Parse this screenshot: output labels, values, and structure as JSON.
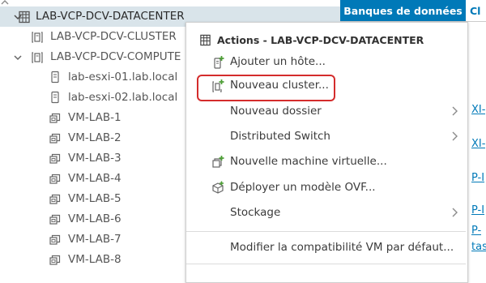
{
  "tree": {
    "items": [
      {
        "label": "LAB-VCP-DCV-DATACENTER",
        "type": "datacenter",
        "selected": true
      },
      {
        "label": "LAB-VCP-DCV-CLUSTER",
        "type": "cluster"
      },
      {
        "label": "LAB-VCP-DCV-COMPUTE",
        "type": "cluster",
        "expanded": true
      },
      {
        "label": "lab-esxi-01.lab.local",
        "type": "host"
      },
      {
        "label": "lab-esxi-02.lab.local",
        "type": "host"
      },
      {
        "label": "VM-LAB-1",
        "type": "vm"
      },
      {
        "label": "VM-LAB-2",
        "type": "vm"
      },
      {
        "label": "VM-LAB-3",
        "type": "vm"
      },
      {
        "label": "VM-LAB-4",
        "type": "vm"
      },
      {
        "label": "VM-LAB-5",
        "type": "vm"
      },
      {
        "label": "VM-LAB-6",
        "type": "vm"
      },
      {
        "label": "VM-LAB-7",
        "type": "vm"
      },
      {
        "label": "VM-LAB-8",
        "type": "vm"
      }
    ]
  },
  "right_pane": {
    "active_tab": "Banques de données",
    "next_tab_fragment": "Cl",
    "link_fragments": [
      "XI-",
      "XI-",
      "P-I",
      "P-I",
      "P-",
      "tas"
    ]
  },
  "context_menu": {
    "title": "Actions - LAB-VCP-DCV-DATACENTER",
    "items": [
      {
        "label": "Ajouter un hôte...",
        "icon": "add-host-icon",
        "submenu": false
      },
      {
        "label": "Nouveau cluster...",
        "icon": "new-cluster-icon",
        "submenu": false,
        "highlighted": true
      },
      {
        "label": "Nouveau dossier",
        "icon": "",
        "submenu": true
      },
      {
        "label": "Distributed Switch",
        "icon": "",
        "submenu": true
      },
      {
        "label": "Nouvelle machine virtuelle...",
        "icon": "new-vm-icon",
        "submenu": false
      },
      {
        "label": "Déployer un modèle OVF...",
        "icon": "deploy-ovf-icon",
        "submenu": false
      },
      {
        "label": "Stockage",
        "icon": "",
        "submenu": true
      },
      {
        "label": "Modifier la compatibilité VM par défaut...",
        "icon": "",
        "submenu": false
      }
    ]
  },
  "colors": {
    "accent": "#0079b8",
    "selected_row": "#d9e4ea",
    "highlight_border": "#d42c2c",
    "add_green": "#4d9e36"
  }
}
